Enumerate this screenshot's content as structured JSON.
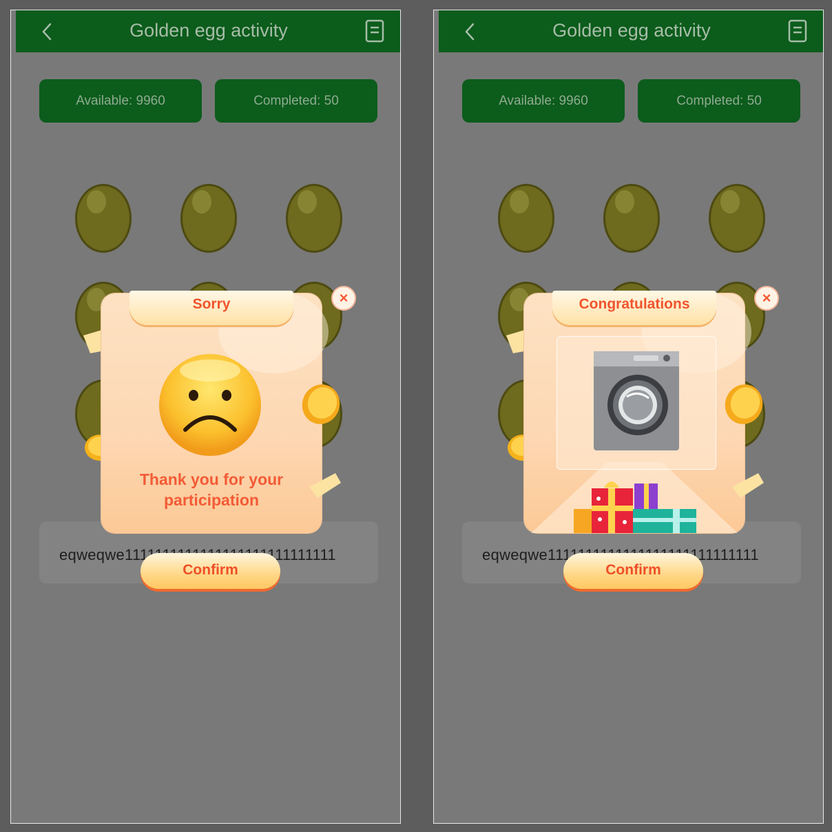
{
  "header": {
    "title": "Golden egg activity",
    "back_icon": "chevron-left-icon",
    "records_icon": "document-icon"
  },
  "stats": {
    "available": "Available: 9960",
    "completed": "Completed: 50"
  },
  "history_text": "eqweqwe1111111111111111111111111111",
  "modals": {
    "left": {
      "title": "Sorry",
      "message": "Thank you for your participation",
      "confirm": "Confirm",
      "close": "×",
      "image_icon": "sad-face-icon"
    },
    "right": {
      "title": "Congratulations",
      "confirm": "Confirm",
      "close": "×",
      "image_icon": "washing-machine-icon"
    }
  },
  "colors": {
    "header_green": "#0c5c1c",
    "overlay_gray": "#797979",
    "accent_orange": "#f0542d",
    "egg_gold": "#6e6a1e"
  }
}
